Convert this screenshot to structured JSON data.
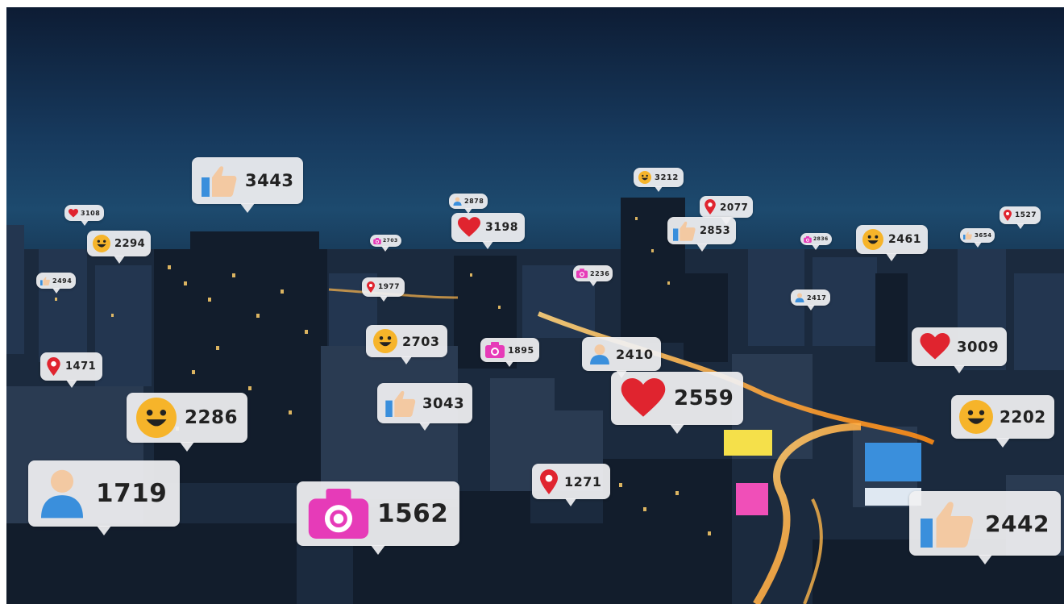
{
  "colors": {
    "heart": "#e0242f",
    "pin": "#e0242f",
    "camera": "#e63bb8",
    "face": "#f6b42a",
    "user": "#3a8fdc",
    "like_thumb": "#f3c9a2",
    "like_cuff": "#3a8fdc"
  },
  "bubbles": [
    {
      "icon": "heart-icon",
      "count": "3108"
    },
    {
      "icon": "smiley-face-icon",
      "count": "2294"
    },
    {
      "icon": "thumbs-up-icon",
      "count": "3443"
    },
    {
      "icon": "thumbs-up-icon",
      "count": "2494"
    },
    {
      "icon": "camera-icon",
      "count": "2703"
    },
    {
      "icon": "user-icon",
      "count": "2878"
    },
    {
      "icon": "heart-icon",
      "count": "3198"
    },
    {
      "icon": "smiley-face-icon",
      "count": "3212"
    },
    {
      "icon": "location-pin-icon",
      "count": "2077"
    },
    {
      "icon": "thumbs-up-icon",
      "count": "2853"
    },
    {
      "icon": "camera-icon",
      "count": "2236"
    },
    {
      "icon": "location-pin-icon",
      "count": "1977"
    },
    {
      "icon": "camera-icon",
      "count": "2836"
    },
    {
      "icon": "smiley-face-icon",
      "count": "2461"
    },
    {
      "icon": "thumbs-up-icon",
      "count": "3654"
    },
    {
      "icon": "location-pin-icon",
      "count": "1527"
    },
    {
      "icon": "user-icon",
      "count": "2417"
    },
    {
      "icon": "location-pin-icon",
      "count": "1471"
    },
    {
      "icon": "smiley-face-icon",
      "count": "2703"
    },
    {
      "icon": "camera-icon",
      "count": "1895"
    },
    {
      "icon": "user-icon",
      "count": "2410"
    },
    {
      "icon": "heart-icon",
      "count": "3009"
    },
    {
      "icon": "smiley-face-icon",
      "count": "2286"
    },
    {
      "icon": "thumbs-up-icon",
      "count": "3043"
    },
    {
      "icon": "heart-icon",
      "count": "2559"
    },
    {
      "icon": "smiley-face-icon",
      "count": "2202"
    },
    {
      "icon": "user-icon",
      "count": "1719"
    },
    {
      "icon": "camera-icon",
      "count": "1562"
    },
    {
      "icon": "location-pin-icon",
      "count": "1271"
    },
    {
      "icon": "thumbs-up-icon",
      "count": "2442"
    }
  ]
}
